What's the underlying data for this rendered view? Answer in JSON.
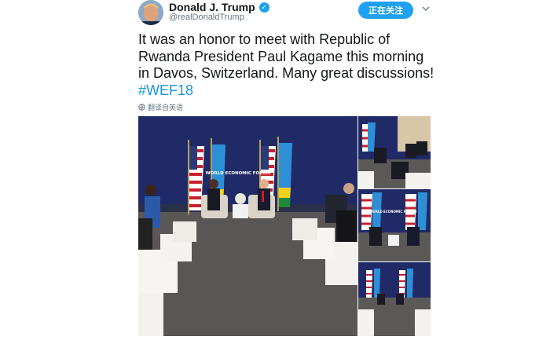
{
  "user": {
    "name": "Donald J. Trump",
    "handle": "@realDonaldTrump",
    "verified": true
  },
  "follow_button": {
    "label": "正在关注"
  },
  "tweet": {
    "text": "It was an honor to meet with Republic of Rwanda President Paul Kagame this morning in Davos, Switzerland. Many great discussions! ",
    "hashtag": "#WEF18"
  },
  "translate": {
    "label": "翻译自英语",
    "icon": "globe-icon"
  },
  "photos": {
    "main_banner": "WORLD ECONOMIC FORUM",
    "banner_small": "WORLD ECONOMIC FORUM"
  },
  "colors": {
    "accent": "#1da1f2",
    "hashtag": "#1b95e0",
    "backdrop": "#1f2a66",
    "carpet": "#5a5656"
  }
}
